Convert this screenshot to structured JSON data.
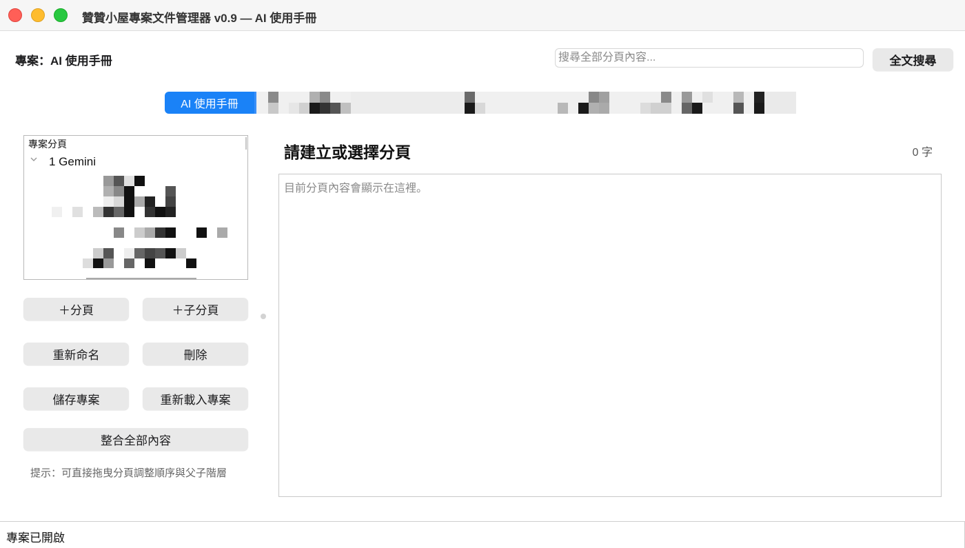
{
  "window": {
    "title": "贊贊小屋專案文件管理器 v0.9 — AI 使用手冊",
    "buttons": [
      "close",
      "minimize",
      "maximize"
    ]
  },
  "header": {
    "project_prefix": "專案：",
    "project_name": "AI 使用手冊",
    "search_placeholder": "搜尋全部分頁內容...",
    "search_button": "全文搜尋"
  },
  "tabs": {
    "active_label": "AI 使用手冊",
    "active_color": "#1a82f7"
  },
  "sidebar": {
    "tree_header": "專案分頁",
    "tree_items": [
      {
        "label": "1 Gemini",
        "expanded": true
      }
    ],
    "buttons": {
      "add_page": "＋分頁",
      "add_child_page": "＋子分頁",
      "rename": "重新命名",
      "delete": "刪除",
      "save_project": "儲存專案",
      "reload_project": "重新載入專案",
      "merge_all": "整合全部內容"
    },
    "hint": "提示：可直接拖曳分頁調整順序與父子階層"
  },
  "editor": {
    "page_title": "請建立或選擇分頁",
    "word_count": "0 字",
    "placeholder": "目前分頁內容會顯示在這裡。"
  },
  "status": {
    "text": "專案已開啟"
  }
}
